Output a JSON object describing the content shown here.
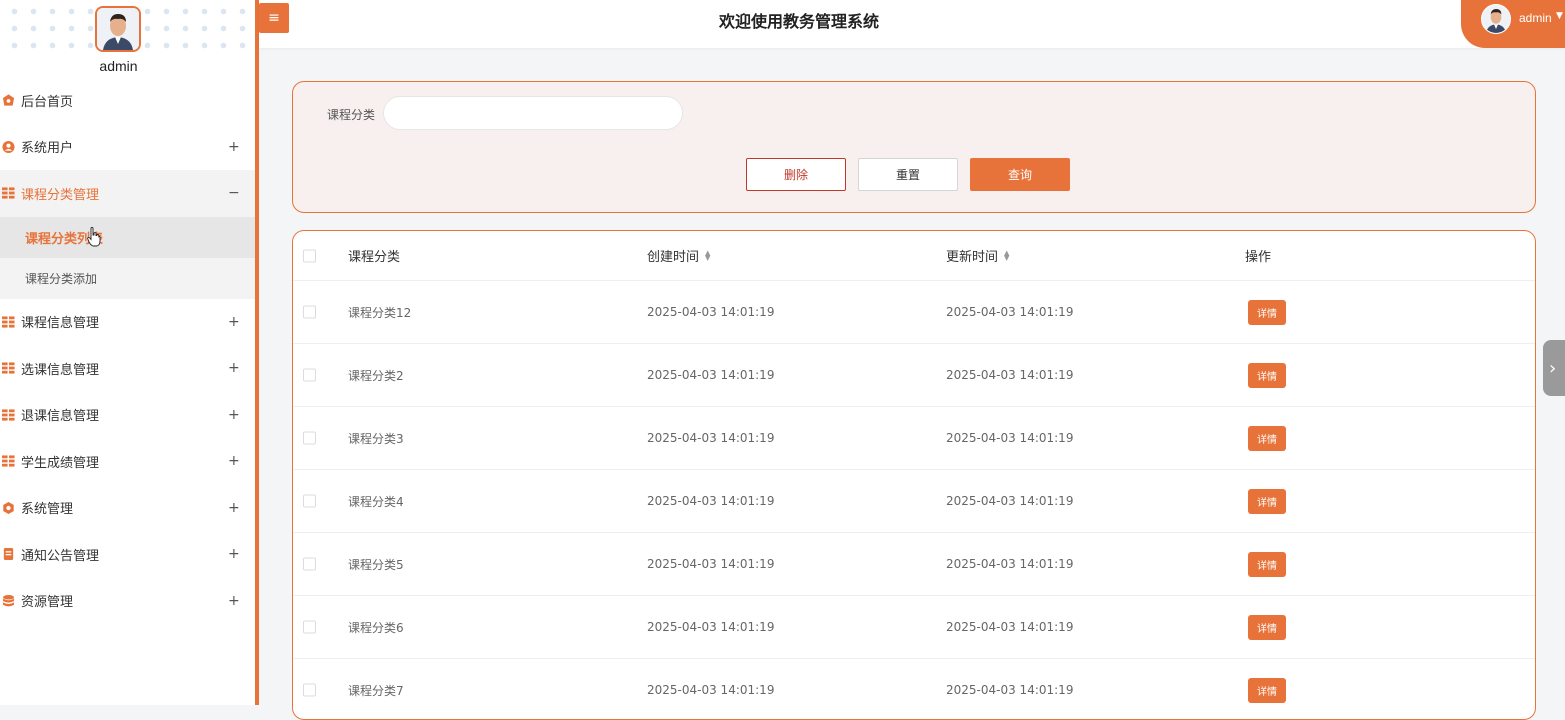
{
  "sidebar": {
    "username": "admin",
    "menu": [
      {
        "label": "后台首页",
        "icon": "home-icon",
        "toggle": ""
      },
      {
        "label": "系统用户",
        "icon": "user-icon",
        "toggle": "+"
      },
      {
        "label": "课程分类管理",
        "icon": "grid-icon",
        "toggle": "−",
        "active": true
      },
      {
        "label": "课程信息管理",
        "icon": "grid-icon",
        "toggle": "+"
      },
      {
        "label": "选课信息管理",
        "icon": "grid-icon",
        "toggle": "+"
      },
      {
        "label": "退课信息管理",
        "icon": "grid-icon",
        "toggle": "+"
      },
      {
        "label": "学生成绩管理",
        "icon": "grid-icon",
        "toggle": "+"
      },
      {
        "label": "系统管理",
        "icon": "gear-icon",
        "toggle": "+"
      },
      {
        "label": "通知公告管理",
        "icon": "notice-icon",
        "toggle": "+"
      },
      {
        "label": "资源管理",
        "icon": "database-icon",
        "toggle": "+"
      }
    ],
    "submenu": [
      {
        "label": "课程分类列表",
        "current": true
      },
      {
        "label": "课程分类添加",
        "current": false
      }
    ]
  },
  "header": {
    "menu_toggle": "≡",
    "title": "欢迎使用教务管理系统",
    "user": "admin"
  },
  "search": {
    "label": "课程分类",
    "value": "",
    "placeholder": "",
    "delete_label": "删除",
    "reset_label": "重置",
    "query_label": "查询"
  },
  "table": {
    "columns": [
      "课程分类",
      "创建时间",
      "更新时间",
      "操作"
    ],
    "rows": [
      {
        "name": "课程分类12",
        "created": "2025-04-03 14:01:19",
        "updated": "2025-04-03 14:01:19"
      },
      {
        "name": "课程分类2",
        "created": "2025-04-03 14:01:19",
        "updated": "2025-04-03 14:01:19"
      },
      {
        "name": "课程分类3",
        "created": "2025-04-03 14:01:19",
        "updated": "2025-04-03 14:01:19"
      },
      {
        "name": "课程分类4",
        "created": "2025-04-03 14:01:19",
        "updated": "2025-04-03 14:01:19"
      },
      {
        "name": "课程分类5",
        "created": "2025-04-03 14:01:19",
        "updated": "2025-04-03 14:01:19"
      },
      {
        "name": "课程分类6",
        "created": "2025-04-03 14:01:19",
        "updated": "2025-04-03 14:01:19"
      },
      {
        "name": "课程分类7",
        "created": "2025-04-03 14:01:19",
        "updated": "2025-04-03 14:01:19"
      }
    ],
    "detail_label": "详情"
  },
  "colors": {
    "accent": "#e8733a",
    "danger": "#c0392b",
    "panel_bg": "#f8f0ef"
  }
}
